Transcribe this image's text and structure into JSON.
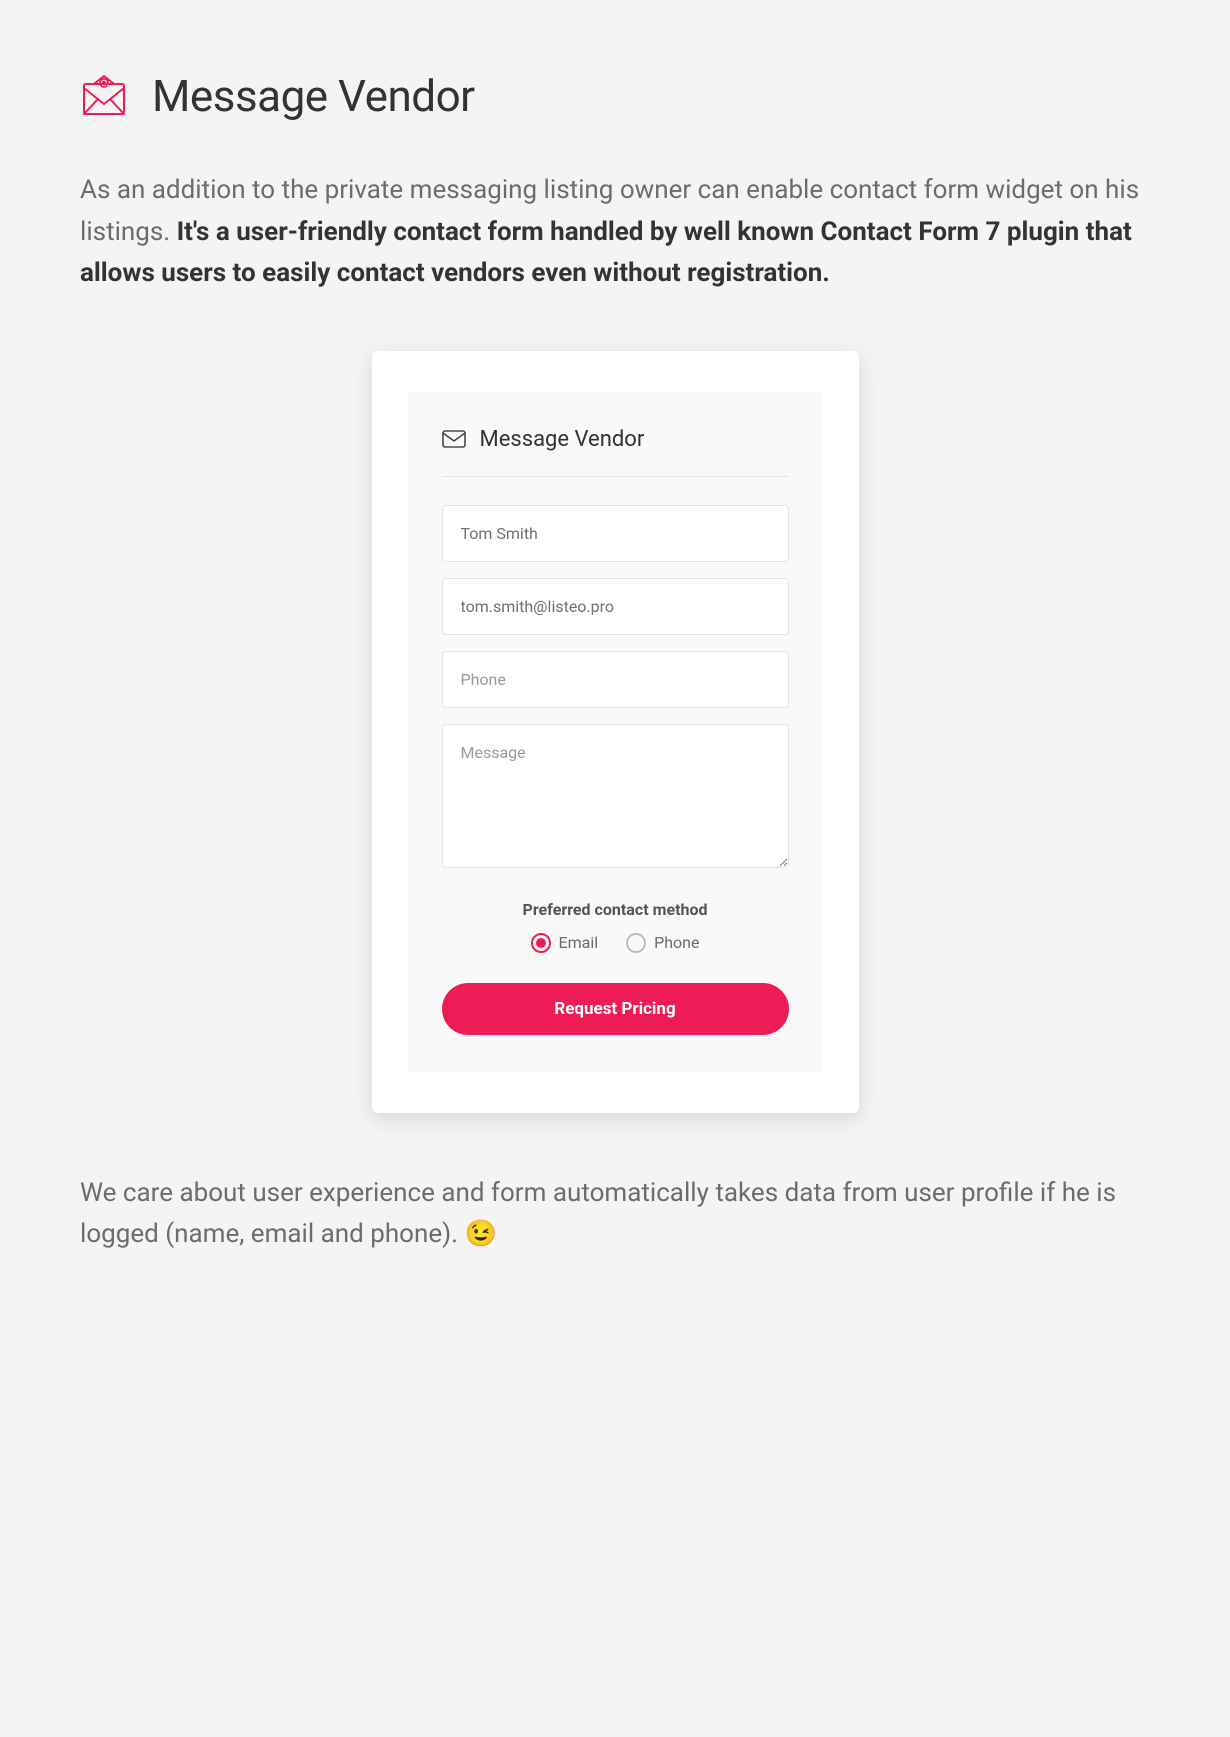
{
  "heading": {
    "title": "Message Vendor"
  },
  "intro": {
    "lead": "As an addition to the private messaging listing owner can enable contact form widget on his listings. ",
    "bold": "It's a user-friendly contact form handled by well known Contact Form 7 plugin that allows users to easily contact vendors even without registration."
  },
  "widget": {
    "title": "Message Vendor",
    "fields": {
      "name_value": "Tom Smith",
      "email_value": "tom.smith@listeo.pro",
      "phone_placeholder": "Phone",
      "message_placeholder": "Message"
    },
    "preferred": {
      "label": "Preferred contact method",
      "options": {
        "email": "Email",
        "phone": "Phone"
      },
      "selected": "email"
    },
    "submit_label": "Request Pricing"
  },
  "footnote": {
    "text": "We care about user experience and form automatically takes data from user profile if he is logged (name, email and phone). ",
    "emoji": "😉"
  }
}
